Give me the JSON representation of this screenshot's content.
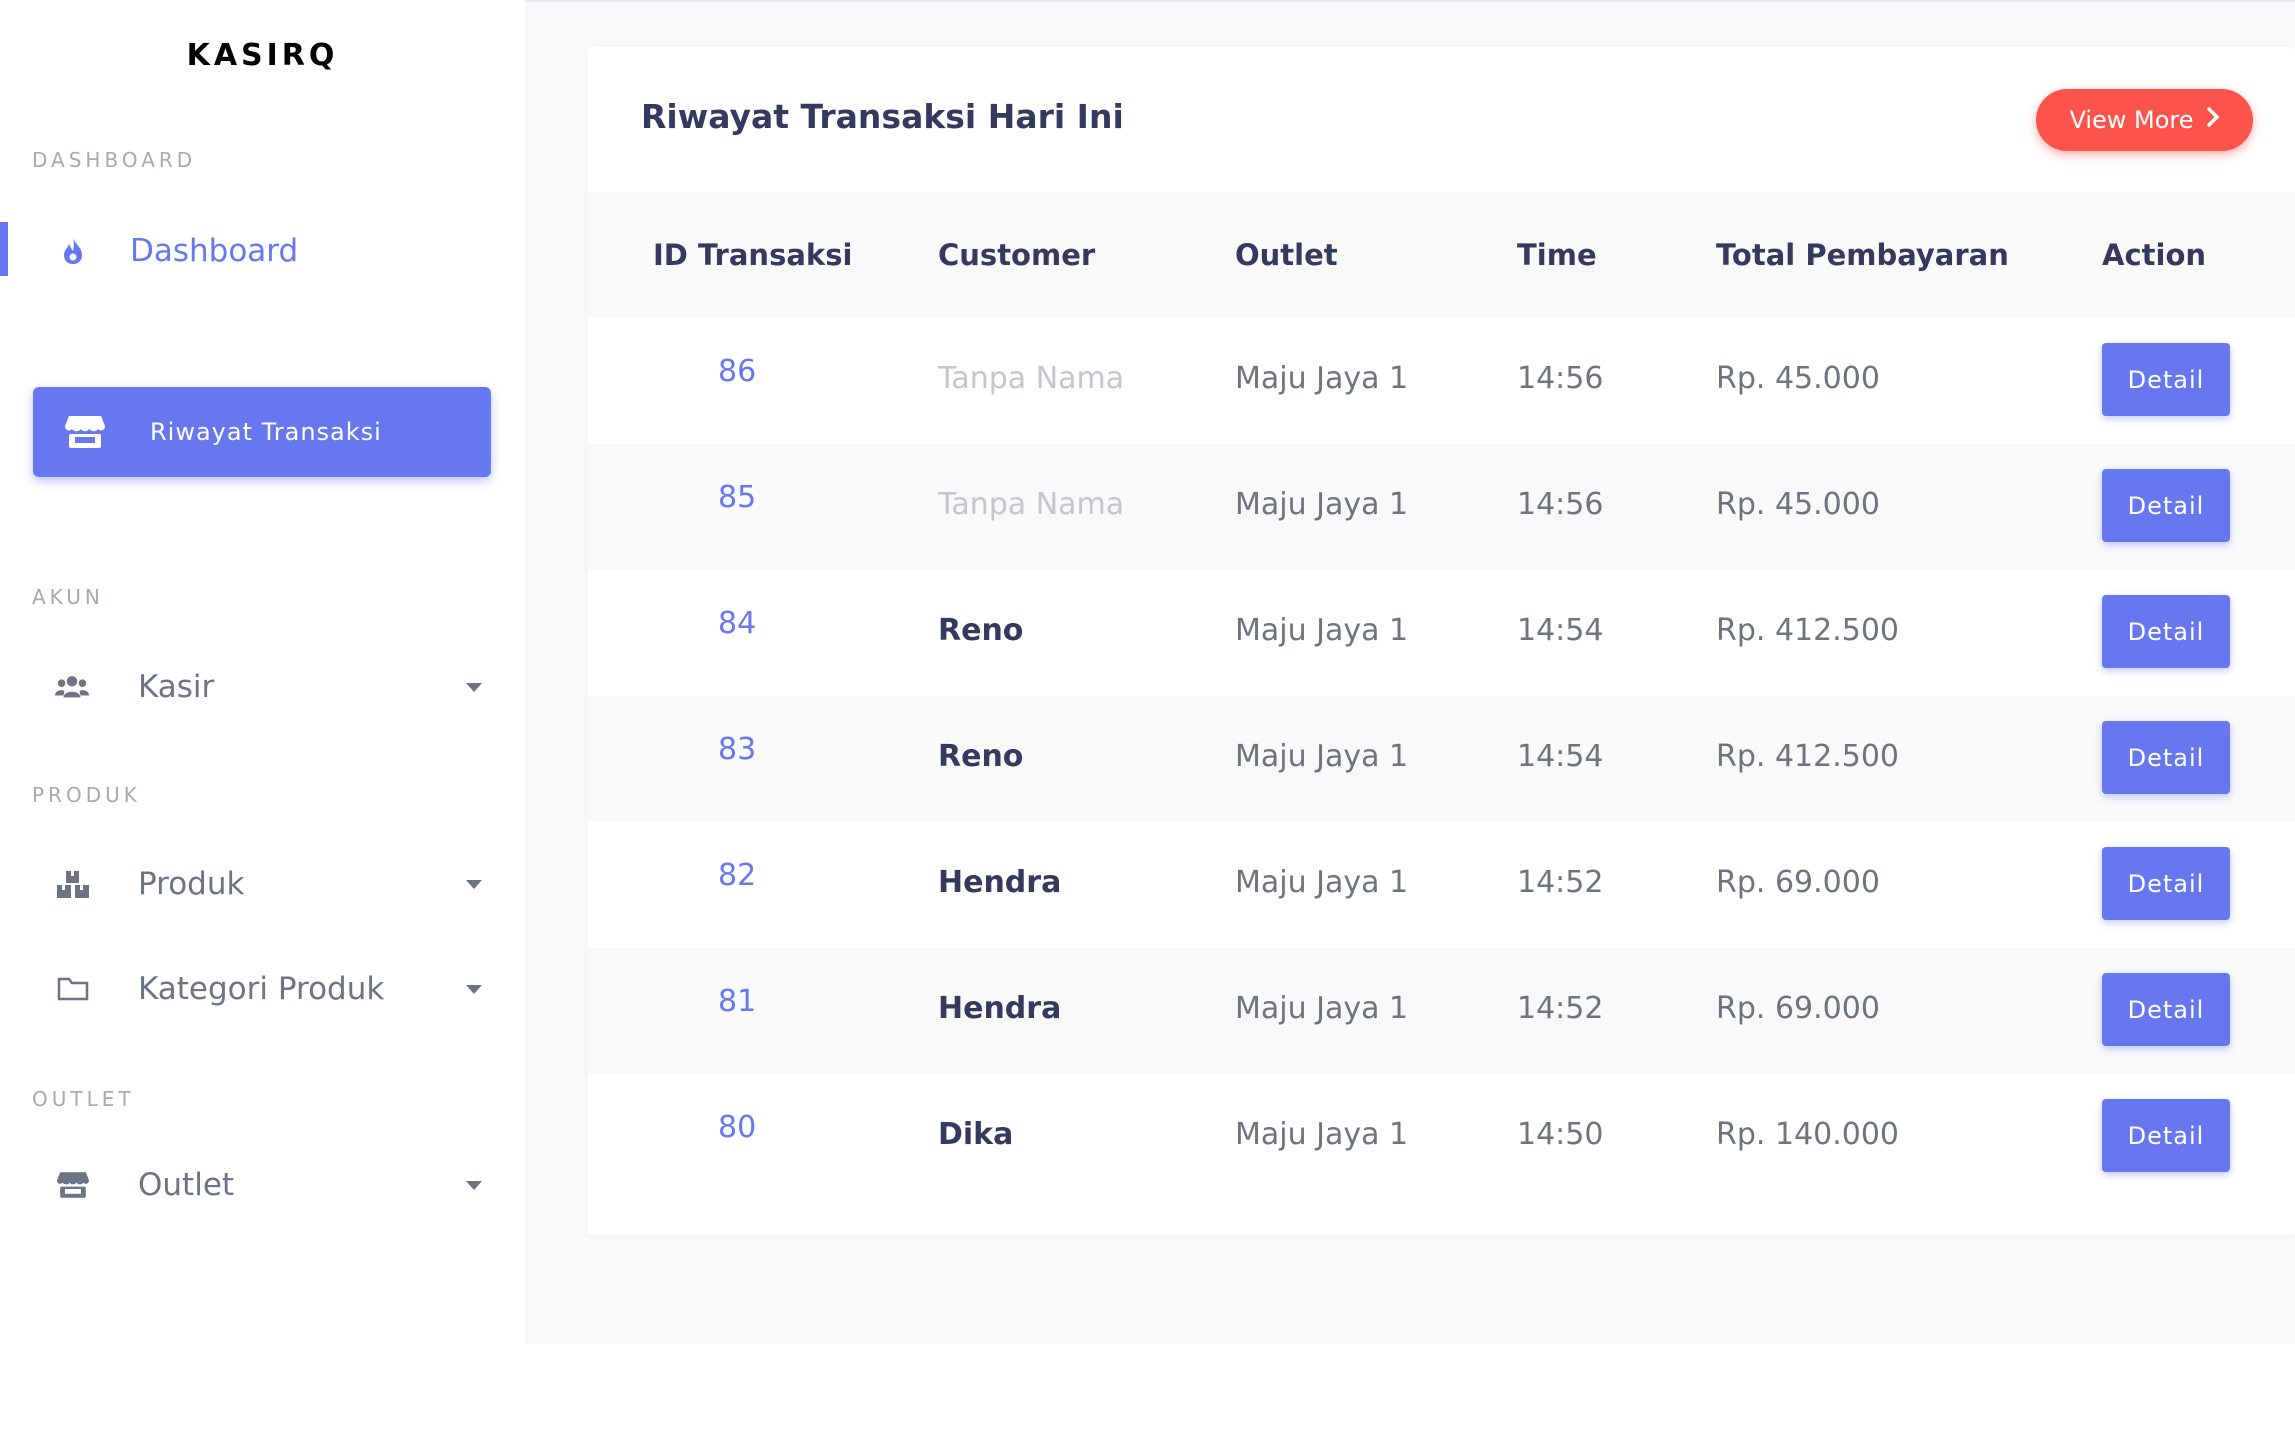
{
  "sidebar": {
    "brand": "KASIRQ",
    "sections": {
      "dashboard": "DASHBOARD",
      "akun": "AKUN",
      "produk": "PRODUK",
      "outlet": "OUTLET"
    },
    "items": {
      "dashboard": {
        "label": "Dashboard",
        "icon": "fire-icon",
        "active": true
      },
      "riwayat": {
        "label": "Riwayat Transaksi",
        "icon": "store-icon"
      },
      "kasir": {
        "label": "Kasir",
        "icon": "users-icon"
      },
      "produk": {
        "label": "Produk",
        "icon": "boxes-icon"
      },
      "kategori": {
        "label": "Kategori Produk",
        "icon": "folder-icon"
      },
      "outlet": {
        "label": "Outlet",
        "icon": "store-icon"
      }
    }
  },
  "card": {
    "title": "Riwayat Transaksi Hari Ini",
    "view_more": "View More"
  },
  "table": {
    "headers": {
      "id": "ID Transaksi",
      "customer": "Customer",
      "outlet": "Outlet",
      "time": "Time",
      "total": "Total Pembayaran",
      "action": "Action"
    },
    "rows": [
      {
        "id": "86",
        "customer": "Tanpa Nama",
        "outlet": "Maju Jaya 1",
        "time": "14:56",
        "total": "Rp. 45.000",
        "action": "Detail"
      },
      {
        "id": "85",
        "customer": "Tanpa Nama",
        "outlet": "Maju Jaya 1",
        "time": "14:56",
        "total": "Rp. 45.000",
        "action": "Detail"
      },
      {
        "id": "84",
        "customer": "Reno",
        "outlet": "Maju Jaya 1",
        "time": "14:54",
        "total": "Rp. 412.500",
        "action": "Detail"
      },
      {
        "id": "83",
        "customer": "Reno",
        "outlet": "Maju Jaya 1",
        "time": "14:54",
        "total": "Rp. 412.500",
        "action": "Detail"
      },
      {
        "id": "82",
        "customer": "Hendra",
        "outlet": "Maju Jaya 1",
        "time": "14:52",
        "total": "Rp. 69.000",
        "action": "Detail"
      },
      {
        "id": "81",
        "customer": "Hendra",
        "outlet": "Maju Jaya 1",
        "time": "14:52",
        "total": "Rp. 69.000",
        "action": "Detail"
      },
      {
        "id": "80",
        "customer": "Dika",
        "outlet": "Maju Jaya 1",
        "time": "14:50",
        "total": "Rp. 140.000",
        "action": "Detail"
      }
    ]
  },
  "colors": {
    "primary": "#6777ef",
    "danger": "#fc544b",
    "muted": "#c3c6cc"
  }
}
